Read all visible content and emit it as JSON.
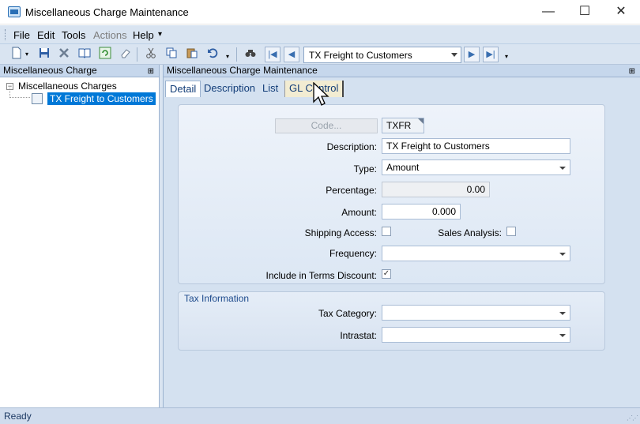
{
  "window": {
    "title": "Miscellaneous Charge Maintenance",
    "minimize": "—",
    "maximize": "☐",
    "close": "✕"
  },
  "menu": {
    "items": [
      "File",
      "Edit",
      "Tools",
      "Actions",
      "Help"
    ],
    "overflow": "▾"
  },
  "toolbar": {
    "record_value": "TX Freight to Customers"
  },
  "left_pane": {
    "header": "Miscellaneous Charge",
    "pin": "⊞",
    "root": "Miscellaneous Charges",
    "root_expander": "−",
    "child": "TX Freight to Customers"
  },
  "right_pane": {
    "header": "Miscellaneous Charge Maintenance",
    "pin": "⊞",
    "tabs": [
      "Detail",
      "Description",
      "List",
      "GL Control"
    ]
  },
  "form": {
    "code_label": "Code...",
    "code_value": "TXFR",
    "description_label": "Description:",
    "description_value": "TX Freight to Customers",
    "type_label": "Type:",
    "type_value": "Amount",
    "percentage_label": "Percentage:",
    "percentage_value": "0.00",
    "amount_label": "Amount:",
    "amount_value": "0.000",
    "shipping_label": "Shipping Access:",
    "sales_analysis_label": "Sales Analysis:",
    "frequency_label": "Frequency:",
    "frequency_value": "",
    "terms_label": "Include in Terms Discount:",
    "terms_checked": "✓"
  },
  "tax": {
    "title": "Tax Information",
    "category_label": "Tax Category:",
    "category_value": "",
    "intrastat_label": "Intrastat:",
    "intrastat_value": ""
  },
  "status": {
    "text": "Ready",
    "grip": "⋰⋰"
  }
}
